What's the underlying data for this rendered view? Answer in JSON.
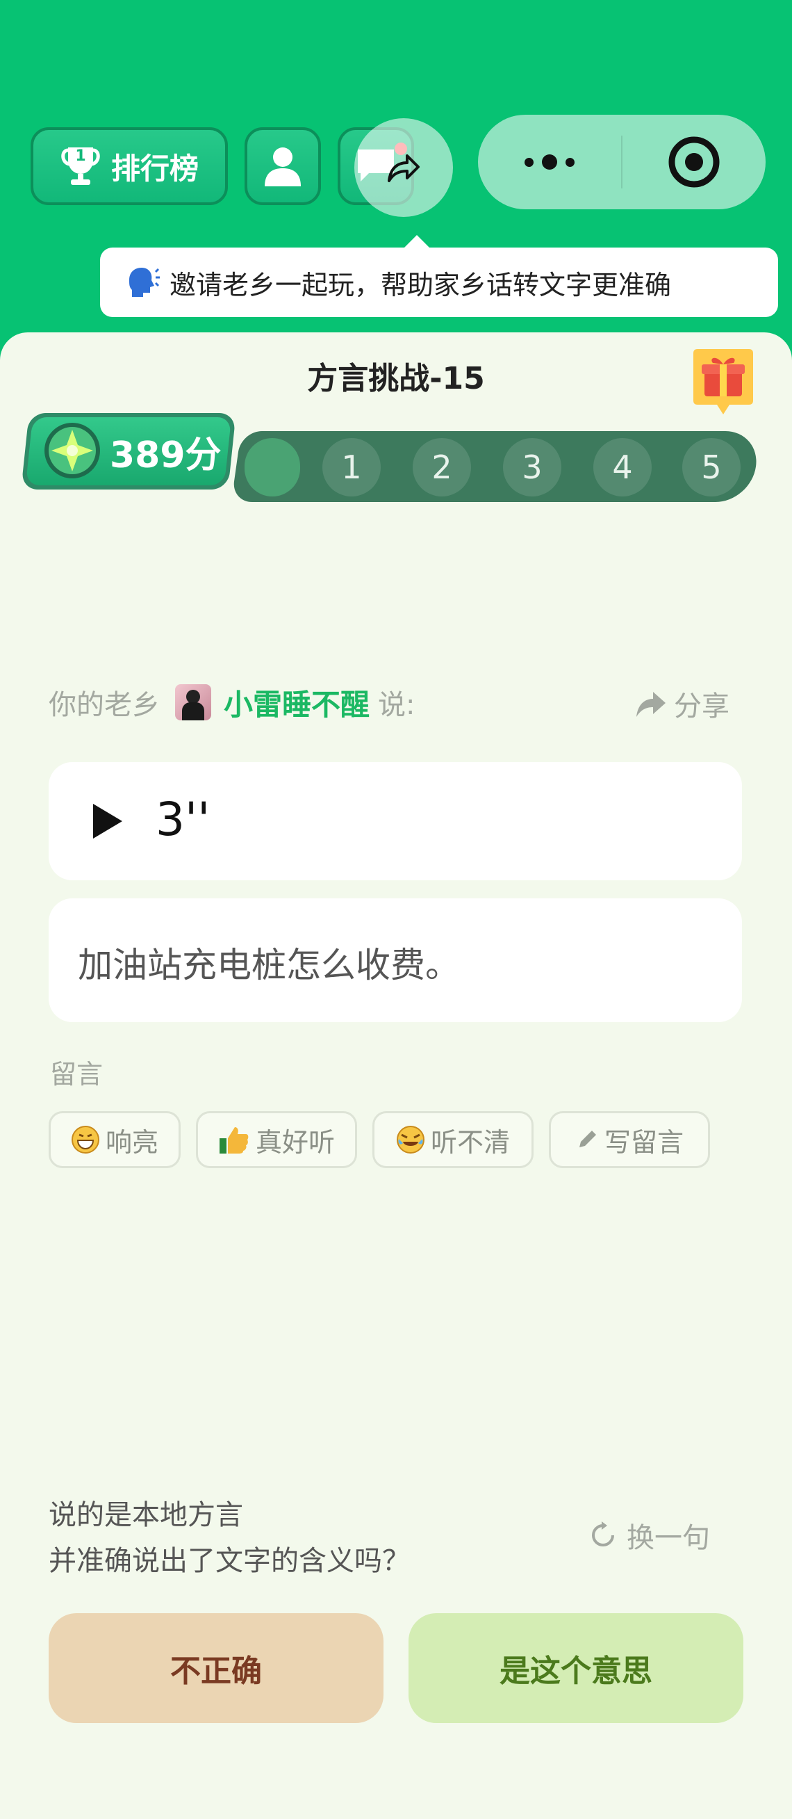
{
  "toolbar": {
    "leaderboard_label": "排行榜",
    "leaderboard_rank": "1"
  },
  "tooltip": {
    "text": "邀请老乡一起玩，帮助家乡话转文字更准确"
  },
  "challenge": {
    "title": "方言挑战-15",
    "score": "389分",
    "steps": [
      "1",
      "2",
      "3",
      "4",
      "5"
    ]
  },
  "speaker": {
    "prefix": "你的老乡",
    "name": "小雷睡不醒",
    "suffix": "说:",
    "share_label": "分享"
  },
  "audio": {
    "duration": "3''"
  },
  "transcript": {
    "text": "加油站充电桩怎么收费。"
  },
  "comments": {
    "header": "留言",
    "chips": [
      {
        "label": "响亮",
        "icon": "grin-emoji"
      },
      {
        "label": "真好听",
        "icon": "thumbs-up-emoji"
      },
      {
        "label": "听不清",
        "icon": "crying-laugh-emoji"
      },
      {
        "label": "写留言",
        "icon": "pencil-icon"
      }
    ]
  },
  "question": {
    "line1": "说的是本地方言",
    "line2": "并准确说出了文字的含义吗？",
    "swap_label": "换一句"
  },
  "actions": {
    "no_label": "不正确",
    "yes_label": "是这个意思"
  },
  "colors": {
    "brand_green": "#07c273",
    "name_green": "#1bb863",
    "no_button": "#ebd5b3",
    "yes_button": "#d4edb4"
  }
}
